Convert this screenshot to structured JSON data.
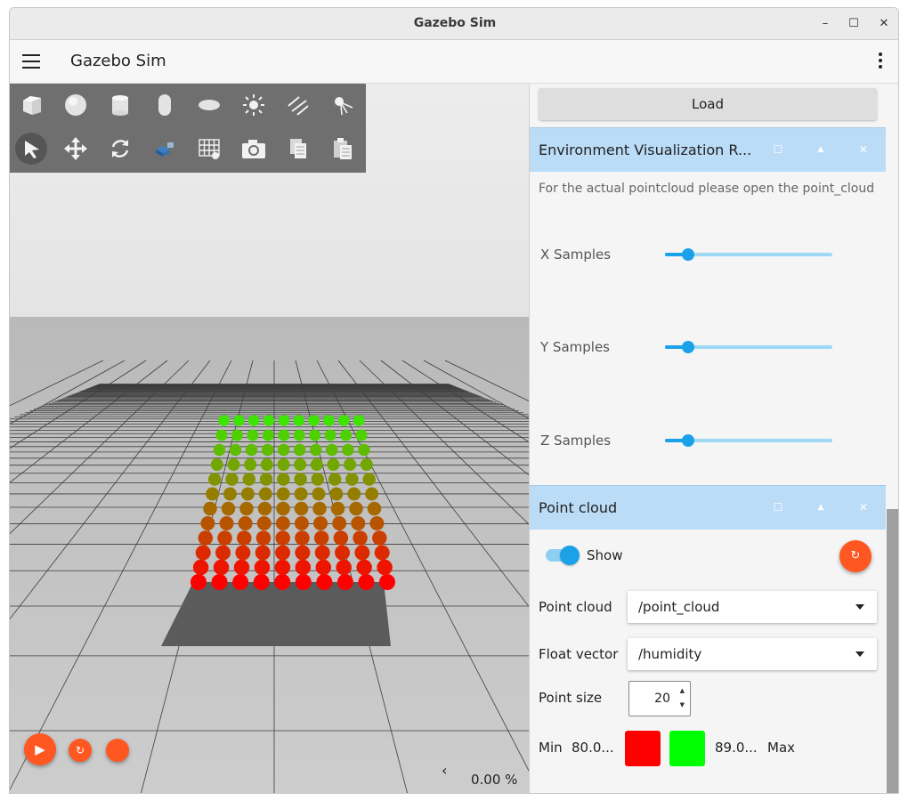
{
  "window": {
    "title": "Gazebo Sim",
    "controls": [
      "–",
      "☐",
      "✕"
    ]
  },
  "appbar": {
    "title": "Gazebo Sim"
  },
  "toolbar": {
    "row1": [
      "box-icon",
      "sphere-icon",
      "cylinder-icon",
      "capsule-icon",
      "ellipsoid-icon",
      "sun-light-icon",
      "directional-light-icon",
      "spot-light-icon"
    ],
    "row2": [
      "select-icon",
      "translate-icon",
      "rotate-icon",
      "transform-snap-icon",
      "grid-icon",
      "camera-icon",
      "copy-icon",
      "paste-icon"
    ]
  },
  "viewport": {
    "percent": "0.00 %",
    "collapse_label": "‹"
  },
  "sidebar": {
    "load_label": "Load",
    "env_panel": {
      "title": "Environment Visualization R...",
      "note": "For the actual pointcloud please open the point_cloud",
      "sliders": [
        {
          "label": "X Samples",
          "value": 0.14
        },
        {
          "label": "Y Samples",
          "value": 0.14
        },
        {
          "label": "Z Samples",
          "value": 0.14
        }
      ]
    },
    "pc_panel": {
      "title": "Point cloud",
      "show_label": "Show",
      "show_enabled": true,
      "point_cloud_label": "Point cloud",
      "point_cloud_value": "/point_cloud",
      "float_vector_label": "Float vector",
      "float_vector_value": "/humidity",
      "point_size_label": "Point size",
      "point_size_value": "20",
      "min_label": "Min",
      "min_value": "80.0...",
      "max_value": "89.0...",
      "max_label": "Max",
      "min_color": "#ff0000",
      "max_color": "#00ff00"
    }
  },
  "colors": {
    "accent": "#1ba1e8",
    "fab": "#ff5722",
    "panel_header": "#bbdcf7"
  }
}
